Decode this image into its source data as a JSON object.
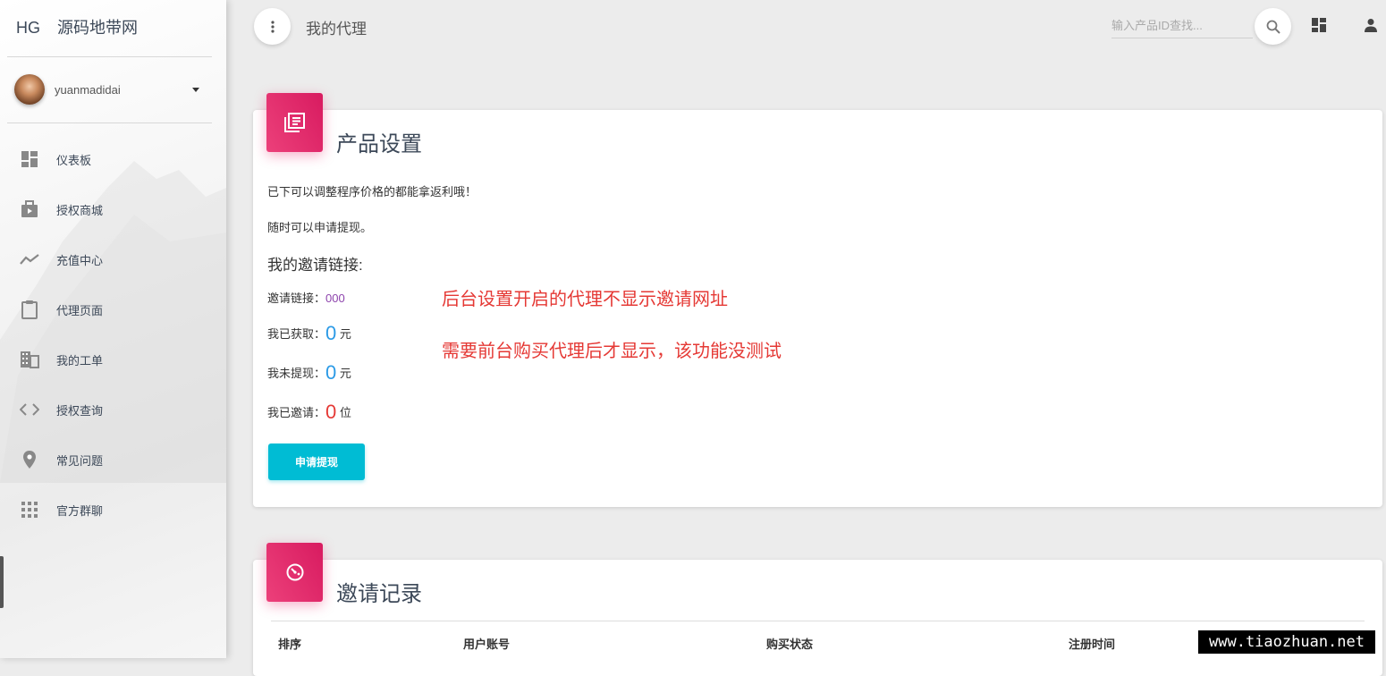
{
  "sidebar": {
    "brand_mini": "HG",
    "brand_name": "源码地带网",
    "username": "yuanmadidai",
    "items": [
      {
        "label": "仪表板",
        "icon": "dashboard-icon"
      },
      {
        "label": "授权商城",
        "icon": "shop-bag-icon"
      },
      {
        "label": "充值中心",
        "icon": "trending-icon"
      },
      {
        "label": "代理页面",
        "icon": "clipboard-icon"
      },
      {
        "label": "我的工单",
        "icon": "building-icon"
      },
      {
        "label": "授权查询",
        "icon": "code-icon"
      },
      {
        "label": "常见问题",
        "icon": "location-pin-icon"
      },
      {
        "label": "官方群聊",
        "icon": "apps-grid-icon"
      }
    ]
  },
  "topbar": {
    "title": "我的代理",
    "search_placeholder": "输入产品ID查找..."
  },
  "product_card": {
    "title": "产品设置",
    "line1": "已下可以调整程序价格的都能拿返利哦！",
    "line2": "随时可以申请提现。",
    "invite_heading": "我的邀请链接:",
    "invite_link_label": "邀请链接：",
    "invite_link_value": "000",
    "earned_label": "我已获取：",
    "earned_value": "0",
    "earned_unit": "元",
    "unwithdrawn_label": "我未提现：",
    "unwithdrawn_value": "0",
    "unwithdrawn_unit": "元",
    "invited_label": "我已邀请：",
    "invited_value": "0",
    "invited_unit": "位",
    "withdraw_button": "申请提现",
    "note1": "后台设置开启的代理不显示邀请网址",
    "note2": "需要前台购买代理后才显示，该功能没测试"
  },
  "invite_card": {
    "title": "邀请记录",
    "columns": [
      "排序",
      "用户账号",
      "购买状态",
      "注册时间"
    ]
  },
  "watermark": "www.tiaozhuan.net",
  "colors": {
    "accent_pink": "#e91e63",
    "button_cyan": "#00bcd4",
    "note_red": "#e53935",
    "value_blue": "#2b9ae6"
  }
}
